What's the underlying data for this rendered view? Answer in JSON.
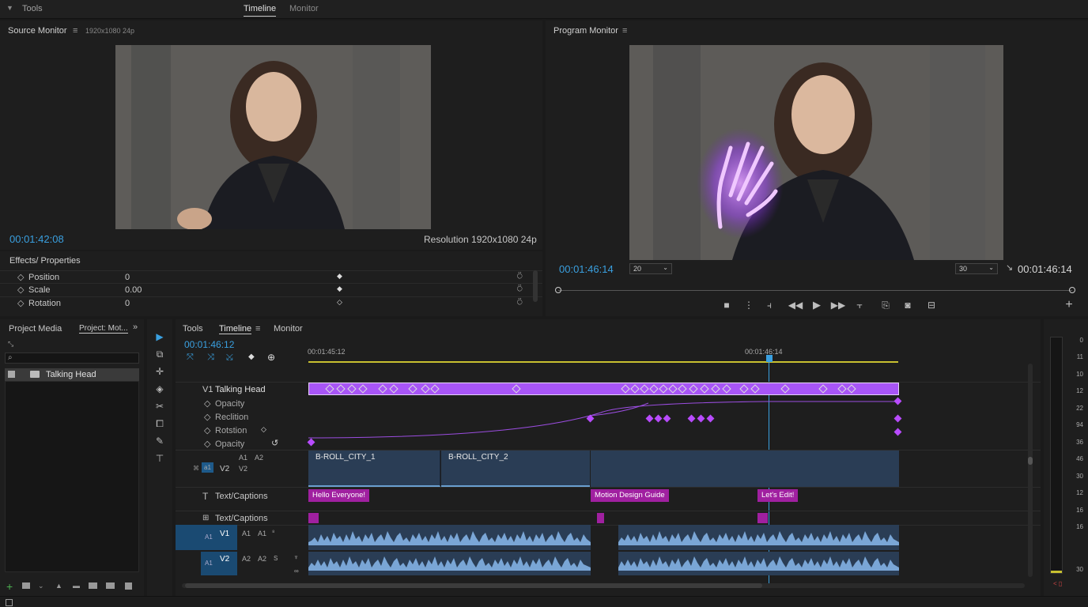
{
  "topbar": {
    "tools_label": "Tools",
    "tabs": [
      "Timeline",
      "Monitor"
    ]
  },
  "source_monitor": {
    "title": "Source Monitor",
    "menu_icon": "≡",
    "format": "1920x1080  24p",
    "timecode": "00:01:42:08",
    "resolution": "Resolution 1920x1080 24p"
  },
  "program_monitor": {
    "title": "Program Monitor",
    "menu_icon": "≡",
    "zoom_left": "20",
    "zoom_right": "30",
    "timecode_left": "00:01:46:14",
    "timecode_right": "00:01:46:14"
  },
  "effects": {
    "title": "Effects/ Properties",
    "rows": [
      {
        "label": "Position",
        "value": "0"
      },
      {
        "label": "Scale",
        "value": "0.00"
      },
      {
        "label": "Rotation",
        "value": "0"
      }
    ]
  },
  "project": {
    "tabs": [
      "Project Media",
      "Project: Mot..."
    ],
    "items": [
      {
        "label": "Talking Head"
      }
    ]
  },
  "timeline": {
    "tabs": [
      "Tools",
      "Timeline",
      "Monitor"
    ],
    "timecode": "00:01:46:12",
    "ruler_left": "00:01:45:12",
    "ruler_right": "00:01:46:14",
    "tracks": {
      "v1_label": "V1",
      "v1_name": "Talking Head",
      "props": [
        "Opacity",
        "Reclition",
        "Rotstion",
        "Opacity"
      ],
      "a1": "A1",
      "a2": "A2",
      "v2": "V2",
      "v2b": "V2",
      "text1": "Text/Captions",
      "text2": "Text/Captions",
      "audio1": [
        "A1",
        "V1",
        "A1",
        "A1"
      ],
      "audio2": [
        "A1",
        "V2",
        "A2",
        "A2"
      ]
    },
    "clips": {
      "broll1": "B-ROLL_CITY_1",
      "broll2": "B-ROLL_CITY_2",
      "cap1": "Hello Everyone!",
      "cap2": "Motion Design Guide",
      "cap3": "Let's Edit!"
    }
  },
  "meter": {
    "labels": [
      "0",
      "11",
      "10",
      "12",
      "22",
      "94",
      "36",
      "46",
      "30",
      "12",
      "16",
      "16",
      "30"
    ]
  },
  "colors": {
    "accent": "#3aa0e0",
    "clip_purple": "#a855f7",
    "caption": "#a020a0",
    "video_clip": "#2a3d55"
  }
}
